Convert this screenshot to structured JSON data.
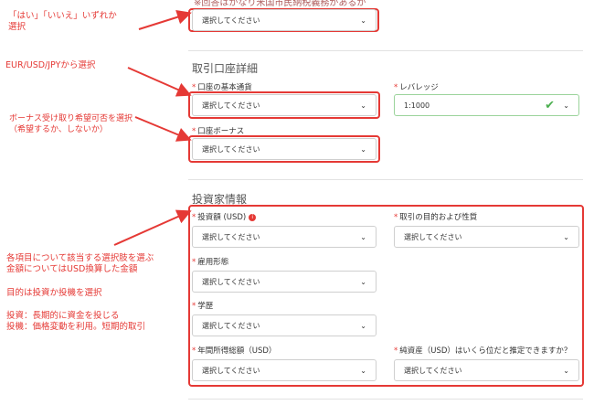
{
  "top_cut_text": "※回答はかなり米国市民納税義務があるか",
  "placeholder": "選択してください",
  "sections": {
    "account": {
      "title": "取引口座詳細"
    },
    "investor": {
      "title": "投資家情報"
    }
  },
  "fields": {
    "base_currency": {
      "label": "口座の基本通貨"
    },
    "leverage": {
      "label": "レバレッジ",
      "value": "1:1000"
    },
    "bonus": {
      "label": "口座ボーナス"
    },
    "investment_amount": {
      "label": "投資額 (USD)"
    },
    "trade_purpose": {
      "label": "取引の目的および性質"
    },
    "employment": {
      "label": "雇用形態"
    },
    "education": {
      "label": "学歴"
    },
    "annual_income": {
      "label": "年間所得総額（USD）"
    },
    "net_worth": {
      "label": "純資産（USD）はいくら位だと推定できますか？"
    }
  },
  "annotations": {
    "yes_no": "「はい」「いいえ」いずれか選択",
    "currency": "EUR/USD/JPYから選択",
    "bonus": "ボーナス受け取り希望可否を選択（希望するか、しないか）",
    "investor_1": "各項目について該当する選択肢を選ぶ",
    "investor_2": "金額についてはUSD換算した金額",
    "purpose": "目的は投資か投機を選択",
    "invest_def": "投資：長期的に資金を投じる",
    "spec_def": "投機：価格変動を利用。短期的取引"
  },
  "colors": {
    "annotation_red": "#e53935",
    "valid_green": "#4caf50"
  }
}
